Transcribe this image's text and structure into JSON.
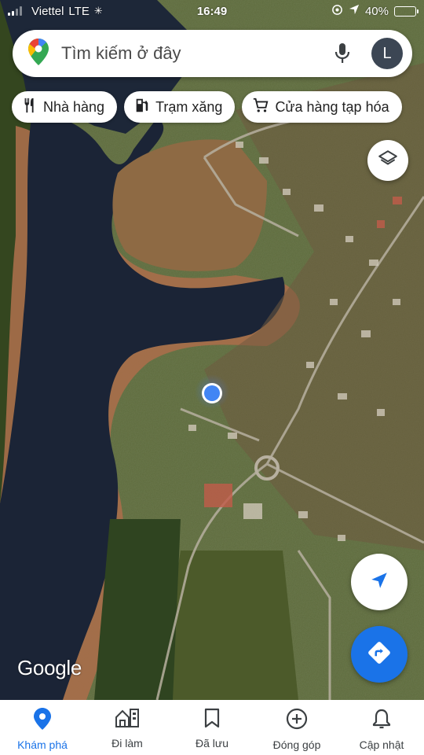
{
  "status_bar": {
    "carrier": "Viettel",
    "network": "LTE",
    "time": "16:49",
    "battery_percent": "40%",
    "battery_level": 0.4
  },
  "search": {
    "placeholder": "Tìm kiếm ở đây",
    "avatar_initial": "L"
  },
  "chips": [
    {
      "label": "Nhà hàng",
      "icon": "restaurant-icon"
    },
    {
      "label": "Trạm xăng",
      "icon": "gas-station-icon"
    },
    {
      "label": "Cửa hàng tạp hóa",
      "icon": "shopping-cart-icon"
    }
  ],
  "map": {
    "attribution": "Google",
    "accent_color": "#1a73e8"
  },
  "bottom_nav": [
    {
      "label": "Khám phá",
      "icon": "explore-pin-icon",
      "active": true
    },
    {
      "label": "Đi làm",
      "icon": "commute-icon",
      "active": false
    },
    {
      "label": "Đã lưu",
      "icon": "bookmark-icon",
      "active": false
    },
    {
      "label": "Đóng góp",
      "icon": "add-circle-icon",
      "active": false
    },
    {
      "label": "Cập nhật",
      "icon": "bell-icon",
      "active": false
    }
  ]
}
